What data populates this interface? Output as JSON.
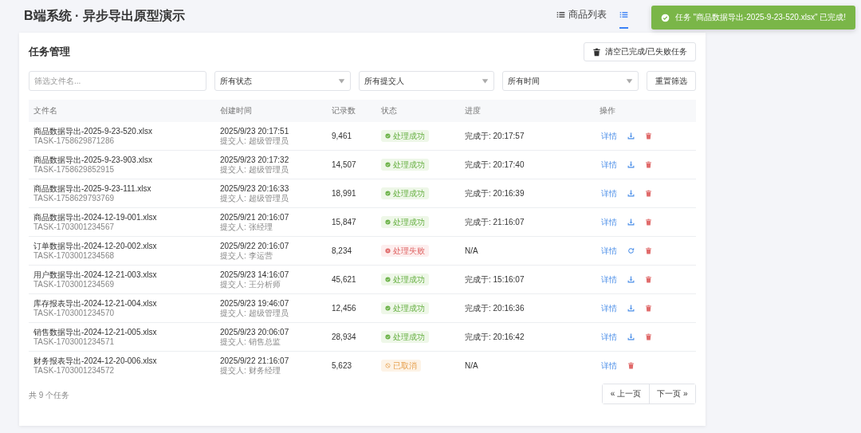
{
  "app_title": "B端系统 · 异步导出原型演示",
  "nav_tabs": [
    {
      "label": "商品列表",
      "selected": false
    },
    {
      "selected": true
    }
  ],
  "toast": {
    "kind": "success",
    "message": "任务 \"商品数据导出-2025-9-23-520.xlsx\" 已完成!"
  },
  "panel": {
    "title": "任务管理",
    "clear_button": "清空已完成/已失败任务"
  },
  "filters": {
    "search": {
      "placeholder": "筛选文件名..."
    },
    "selects": [
      "所有状态",
      "所有提交人",
      "所有时间"
    ],
    "reset_button": "重置筛选"
  },
  "table": {
    "columns": [
      "文件名",
      "创建时间",
      "记录数",
      "状态",
      "进度",
      "操作"
    ],
    "rows": [
      {
        "file": "商品数据导出-2025-9-23-520.xlsx",
        "task_id": "TASK-1758629871286",
        "created": "2025/9/23 20:17:51",
        "submitter": "提交人: 超级管理员",
        "records": "9,461",
        "status": {
          "kind": "success",
          "label": "处理成功"
        },
        "progress": "完成于: 20:17:57",
        "actions": [
          {
            "kind": "link",
            "label": "详情"
          },
          {
            "kind": "download"
          },
          {
            "kind": "delete"
          }
        ]
      },
      {
        "file": "商品数据导出-2025-9-23-903.xlsx",
        "task_id": "TASK-1758629852915",
        "created": "2025/9/23 20:17:32",
        "submitter": "提交人: 超级管理员",
        "records": "14,507",
        "status": {
          "kind": "success",
          "label": "处理成功"
        },
        "progress": "完成于: 20:17:40",
        "actions": [
          {
            "kind": "link",
            "label": "详情"
          },
          {
            "kind": "download"
          },
          {
            "kind": "delete"
          }
        ]
      },
      {
        "file": "商品数据导出-2025-9-23-111.xlsx",
        "task_id": "TASK-1758629793769",
        "created": "2025/9/23 20:16:33",
        "submitter": "提交人: 超级管理员",
        "records": "18,991",
        "status": {
          "kind": "success",
          "label": "处理成功"
        },
        "progress": "完成于: 20:16:39",
        "actions": [
          {
            "kind": "link",
            "label": "详情"
          },
          {
            "kind": "download"
          },
          {
            "kind": "delete"
          }
        ]
      },
      {
        "file": "商品数据导出-2024-12-19-001.xlsx",
        "task_id": "TASK-1703001234567",
        "created": "2025/9/21 20:16:07",
        "submitter": "提交人: 张经理",
        "records": "15,847",
        "status": {
          "kind": "success",
          "label": "处理成功"
        },
        "progress": "完成于: 21:16:07",
        "actions": [
          {
            "kind": "link",
            "label": "详情"
          },
          {
            "kind": "download"
          },
          {
            "kind": "delete"
          }
        ]
      },
      {
        "file": "订单数据导出-2024-12-20-002.xlsx",
        "task_id": "TASK-1703001234568",
        "created": "2025/9/22 20:16:07",
        "submitter": "提交人: 李运营",
        "records": "8,234",
        "status": {
          "kind": "failed",
          "label": "处理失败"
        },
        "progress": "N/A",
        "actions": [
          {
            "kind": "link",
            "label": "详情"
          },
          {
            "kind": "retry"
          },
          {
            "kind": "delete"
          }
        ]
      },
      {
        "file": "用户数据导出-2024-12-21-003.xlsx",
        "task_id": "TASK-1703001234569",
        "created": "2025/9/23 14:16:07",
        "submitter": "提交人: 王分析师",
        "records": "45,621",
        "status": {
          "kind": "success",
          "label": "处理成功"
        },
        "progress": "完成于: 15:16:07",
        "actions": [
          {
            "kind": "link",
            "label": "详情"
          },
          {
            "kind": "download"
          },
          {
            "kind": "delete"
          }
        ]
      },
      {
        "file": "库存报表导出-2024-12-21-004.xlsx",
        "task_id": "TASK-1703001234570",
        "created": "2025/9/23 19:46:07",
        "submitter": "提交人: 超级管理员",
        "records": "12,456",
        "status": {
          "kind": "success",
          "label": "处理成功"
        },
        "progress": "完成于: 20:16:36",
        "actions": [
          {
            "kind": "link",
            "label": "详情"
          },
          {
            "kind": "download"
          },
          {
            "kind": "delete"
          }
        ]
      },
      {
        "file": "销售数据导出-2024-12-21-005.xlsx",
        "task_id": "TASK-1703001234571",
        "created": "2025/9/23 20:06:07",
        "submitter": "提交人: 销售总监",
        "records": "28,934",
        "status": {
          "kind": "success",
          "label": "处理成功"
        },
        "progress": "完成于: 20:16:42",
        "actions": [
          {
            "kind": "link",
            "label": "详情"
          },
          {
            "kind": "download"
          },
          {
            "kind": "delete"
          }
        ]
      },
      {
        "file": "财务报表导出-2024-12-20-006.xlsx",
        "task_id": "TASK-1703001234572",
        "created": "2025/9/22 21:16:07",
        "submitter": "提交人: 财务经理",
        "records": "5,623",
        "status": {
          "kind": "cancelled",
          "label": "已取消"
        },
        "progress": "N/A",
        "actions": [
          {
            "kind": "link",
            "label": "详情"
          },
          {
            "kind": "delete"
          }
        ]
      }
    ]
  },
  "footer": {
    "count": "共 9 个任务",
    "prev_button": "« 上一页",
    "next_button": "下一页 »"
  }
}
